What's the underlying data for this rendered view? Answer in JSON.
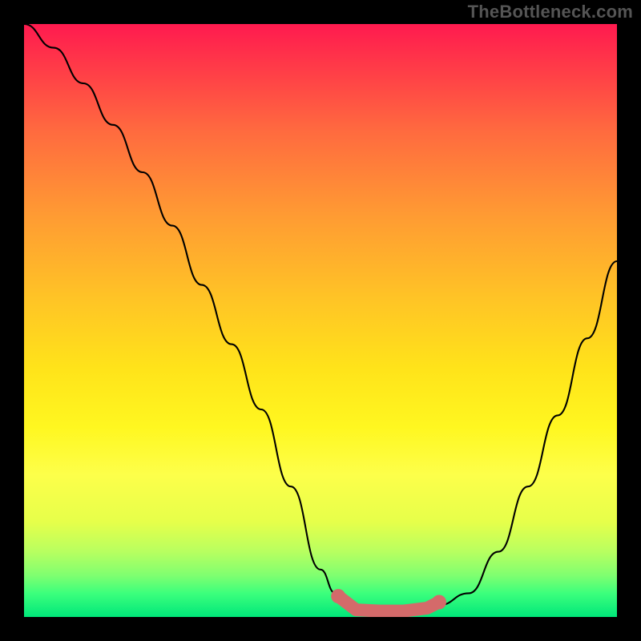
{
  "watermark": "TheBottleneck.com",
  "chart_data": {
    "type": "line",
    "title": "",
    "xlabel": "",
    "ylabel": "",
    "xlim": [
      0,
      100
    ],
    "ylim": [
      0,
      100
    ],
    "series": [
      {
        "name": "bottleneck-curve",
        "x": [
          0,
          5,
          10,
          15,
          20,
          25,
          30,
          35,
          40,
          45,
          50,
          52.5,
          55,
          60,
          65,
          70,
          75,
          80,
          85,
          90,
          95,
          100
        ],
        "values": [
          100,
          96,
          90,
          83,
          75,
          66,
          56,
          46,
          35,
          22,
          8,
          4,
          1,
          1,
          1,
          2,
          4,
          11,
          22,
          34,
          47,
          60
        ]
      }
    ],
    "markers": {
      "name": "highlight-band",
      "color": "#d46a6a",
      "points": [
        {
          "x": 53,
          "y": 3.5
        },
        {
          "x": 56,
          "y": 1.2
        },
        {
          "x": 60,
          "y": 1.0
        },
        {
          "x": 64,
          "y": 1.0
        },
        {
          "x": 68,
          "y": 1.5
        },
        {
          "x": 70,
          "y": 2.5
        }
      ]
    },
    "gradient_stops": [
      {
        "pos": 0.0,
        "color": "#ff1a4f"
      },
      {
        "pos": 0.5,
        "color": "#ffe31a"
      },
      {
        "pos": 1.0,
        "color": "#00e77a"
      }
    ]
  }
}
